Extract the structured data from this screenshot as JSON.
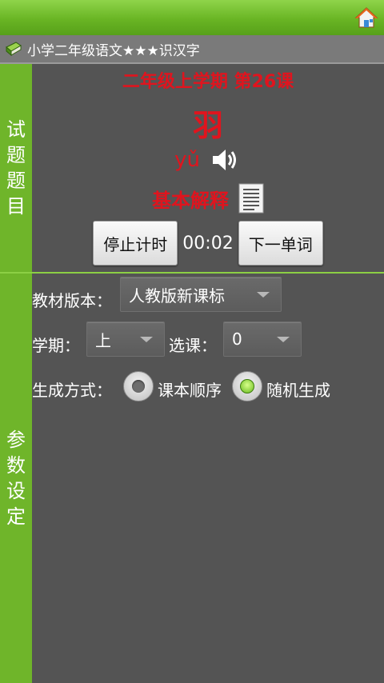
{
  "header": {
    "home_icon": "home-icon",
    "book_icon": "book-icon",
    "title": "小学二年级语文★★★识汉字"
  },
  "sidebar": {
    "question_label": "试题题目",
    "settings_label": "参数设定"
  },
  "question": {
    "lesson": "二年级上学期 第26课",
    "character": "羽",
    "pinyin": "yǔ",
    "speaker_icon": "speaker-icon",
    "explain_label": "基本解释",
    "document_icon": "document-icon",
    "stop_button": "停止计时",
    "timer": "00:02",
    "next_button": "下一单词"
  },
  "settings": {
    "textbook_label": "教材版本：",
    "textbook_value": "人教版新课标",
    "term_label": "学期：",
    "term_value": "上",
    "lesson_label": "选课：",
    "lesson_value": "0",
    "mode_label": "生成方式：",
    "mode_options": [
      {
        "label": "课本顺序",
        "selected": false
      },
      {
        "label": "随机生成",
        "selected": true
      }
    ]
  },
  "colors": {
    "accent_green": "#6fb52a",
    "text_red": "#e0141e",
    "background": "#545454"
  }
}
